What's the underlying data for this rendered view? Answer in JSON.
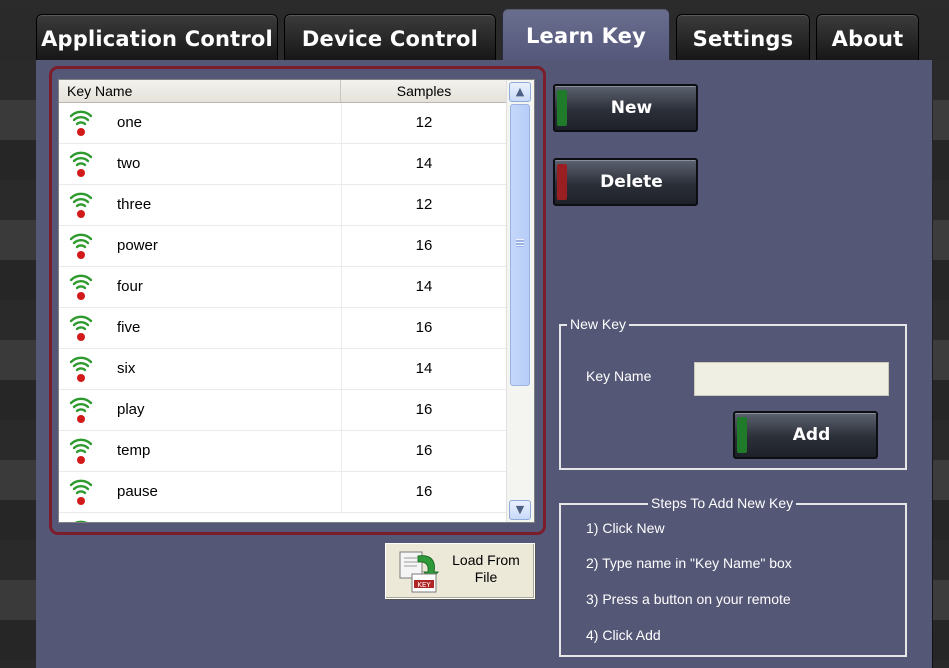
{
  "tabs": [
    {
      "label": "Application Control",
      "active": false
    },
    {
      "label": "Device Control",
      "active": false
    },
    {
      "label": "Learn Key",
      "active": true
    },
    {
      "label": "Settings",
      "active": false
    },
    {
      "label": "About",
      "active": false
    }
  ],
  "list": {
    "columns": {
      "name": "Key Name",
      "samples": "Samples"
    },
    "rows": [
      {
        "name": "one",
        "samples": "12"
      },
      {
        "name": "two",
        "samples": "14"
      },
      {
        "name": "three",
        "samples": "12"
      },
      {
        "name": "power",
        "samples": "16"
      },
      {
        "name": "four",
        "samples": "14"
      },
      {
        "name": "five",
        "samples": "16"
      },
      {
        "name": "six",
        "samples": "14"
      },
      {
        "name": "play",
        "samples": "16"
      },
      {
        "name": "temp",
        "samples": "16"
      },
      {
        "name": "pause",
        "samples": "16"
      }
    ],
    "row_icon": "remote-signal-icon"
  },
  "buttons": {
    "new_label": "New",
    "delete_label": "Delete",
    "add_label": "Add",
    "load_line1": "Load From",
    "load_line2": "File"
  },
  "new_key": {
    "legend": "New Key",
    "field_label": "Key Name",
    "field_value": ""
  },
  "steps": {
    "legend": "Steps To Add New Key",
    "items": [
      "1) Click New",
      "2) Type name in \"Key Name\" box",
      "3) Press a button on your remote",
      "4) Click Add"
    ]
  },
  "colors": {
    "panel": "#545776",
    "list_border": "#7b1d2b",
    "new_led": "#1f7a2a",
    "delete_led": "#9a1f23",
    "signal_green": "#2e9a2e",
    "signal_dot": "#d21a1a"
  }
}
